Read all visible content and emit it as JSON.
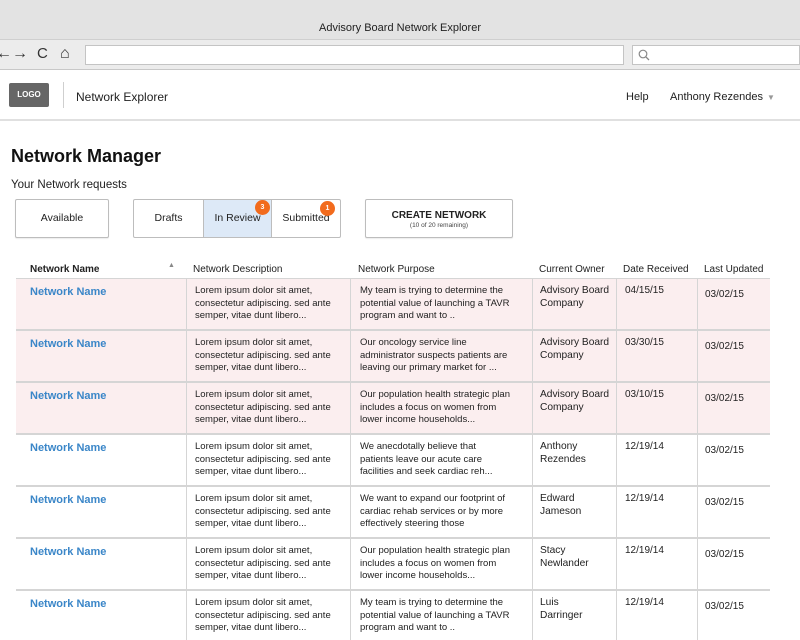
{
  "browser": {
    "window_title": "Advisory Board Network Explorer",
    "nav": {
      "back": "←",
      "forward": "→",
      "reload": "C",
      "home": "⌂"
    },
    "url": "",
    "search_icon": "search-icon"
  },
  "header": {
    "logo": "LOGO",
    "app_name": "Network Explorer",
    "help": "Help",
    "user": "Anthony Rezendes"
  },
  "page": {
    "title": "Network Manager",
    "subtitle": "Your Network requests"
  },
  "filters": {
    "available": "Available",
    "drafts": "Drafts",
    "in_review": "In Review",
    "in_review_count": "3",
    "submitted": "Submitted",
    "submitted_count": "1",
    "selected": "In Review"
  },
  "create": {
    "label": "CREATE NETWORK",
    "sub": "(10 of 20 remaining)"
  },
  "table": {
    "columns": [
      "Network Name",
      "Network Description",
      "Network Purpose",
      "Current Owner",
      "Date Received",
      "Last Updated"
    ],
    "rows": [
      {
        "name": "Network Name",
        "desc": [
          "Lorem ipsum dolor sit amet,",
          "consectetur adipiscing. sed ante",
          "semper, vitae dunt libero..."
        ],
        "purpose": [
          "My team is trying to determine the",
          "potential value of launching a TAVR",
          "program and want to .."
        ],
        "owner": [
          "Advisory Board",
          "Company"
        ],
        "received": "04/15/15",
        "updated": "03/02/15"
      },
      {
        "name": "Network Name",
        "desc": [
          "Lorem ipsum dolor sit amet,",
          "consectetur adipiscing. sed ante",
          "semper, vitae dunt libero..."
        ],
        "purpose": [
          "Our oncology service line",
          "administrator suspects patients are",
          "leaving our primary market for ..."
        ],
        "owner": [
          "Advisory Board",
          "Company"
        ],
        "received": "03/30/15",
        "updated": "03/02/15"
      },
      {
        "name": "Network Name",
        "desc": [
          "Lorem ipsum dolor sit amet,",
          "consectetur adipiscing. sed ante",
          "semper, vitae dunt libero..."
        ],
        "purpose": [
          "Our population health strategic plan",
          "includes a focus on women from",
          "lower income households..."
        ],
        "owner": [
          "Advisory Board",
          "Company"
        ],
        "received": "03/10/15",
        "updated": "03/02/15"
      },
      {
        "name": "Network Name",
        "desc": [
          "Lorem ipsum dolor sit amet,",
          "consectetur adipiscing. sed ante",
          "semper, vitae dunt libero..."
        ],
        "purpose": [
          " We anecdotally believe that",
          "patients leave our acute care",
          "facilities and seek cardiac reh..."
        ],
        "owner": [
          "Anthony",
          "Rezendes"
        ],
        "received": "12/19/14",
        "updated": "03/02/15"
      },
      {
        "name": "Network Name",
        "desc": [
          "Lorem ipsum dolor sit amet,",
          "consectetur adipiscing. sed ante",
          "semper, vitae dunt libero..."
        ],
        "purpose": [
          "We want to expand our footprint of",
          "cardiac rehab services or by more",
          "effectively steering those"
        ],
        "owner": [
          "Edward",
          "Jameson"
        ],
        "received": "12/19/14",
        "updated": "03/02/15"
      },
      {
        "name": "Network Name",
        "desc": [
          "Lorem ipsum dolor sit amet,",
          "consectetur adipiscing. sed ante",
          "semper, vitae dunt libero..."
        ],
        "purpose": [
          "Our population health strategic plan",
          "includes a focus on women from",
          "lower income households..."
        ],
        "owner": [
          "Stacy",
          "Newlander"
        ],
        "received": "12/19/14",
        "updated": "03/02/15"
      },
      {
        "name": "Network Name",
        "desc": [
          "Lorem ipsum dolor sit amet,",
          "consectetur adipiscing. sed ante",
          "semper, vitae dunt libero..."
        ],
        "purpose": [
          "My team is trying to determine the",
          "potential value of launching a TAVR",
          "program and want to .."
        ],
        "owner": [
          "Luis",
          "Darringer"
        ],
        "received": "12/19/14",
        "updated": "03/02/15"
      }
    ]
  },
  "colors": {
    "link": "#3a86c8",
    "badge": "#f26b1d",
    "selected_tab": "#dde9f7",
    "highlight_row": "#fbeeef"
  }
}
